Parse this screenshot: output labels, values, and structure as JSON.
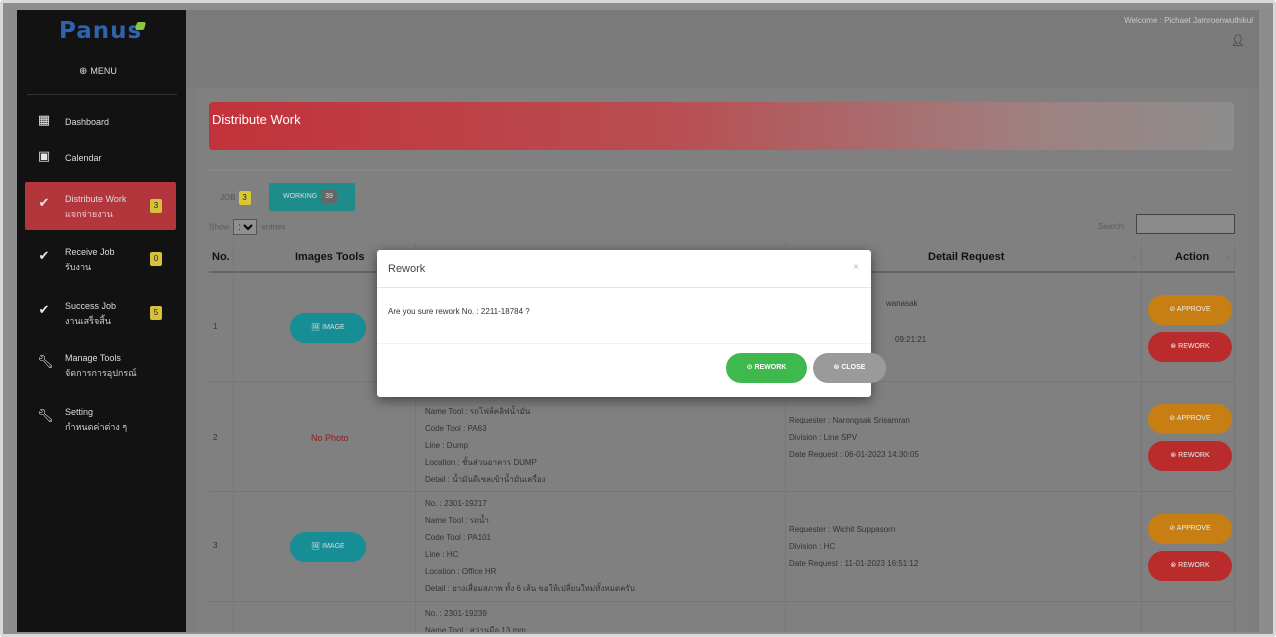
{
  "app": {
    "logo": "Panus",
    "menu_label": "MENU",
    "welcome": "Welcome : Pichaet Jamroenwuthikul"
  },
  "sidebar": {
    "items": [
      {
        "icon": "dashboard-icon",
        "label": "Dashboard",
        "sub": "",
        "badge": ""
      },
      {
        "icon": "calendar-icon",
        "label": "Calendar",
        "sub": "",
        "badge": ""
      },
      {
        "icon": "check-icon",
        "label": "Distribute Work",
        "sub": "แจกจ่ายงาน",
        "badge": "3",
        "active": true
      },
      {
        "icon": "check-icon",
        "label": "Receive Job",
        "sub": "รับงาน",
        "badge": "0"
      },
      {
        "icon": "check-icon",
        "label": "Success Job",
        "sub": "งานเสร็จสิ้น",
        "badge": "5"
      },
      {
        "icon": "wrench-icon",
        "label": "Manage Tools",
        "sub": "จัดการการอุปกรณ์",
        "badge": ""
      },
      {
        "icon": "wrench-icon",
        "label": "Setting",
        "sub": "กำหนดค่าต่าง ๆ",
        "badge": ""
      }
    ]
  },
  "page": {
    "title": "Distribute Work",
    "tab_job": {
      "label": "JOB",
      "count": "3"
    },
    "tab_working": {
      "label": "WORKING",
      "count": "39"
    },
    "show_label": "Show",
    "entries_value": "10",
    "entries_label": "entries",
    "search_label": "Search:"
  },
  "table": {
    "headers": {
      "no": "No.",
      "images": "Images Tools",
      "detail_request": "Detail Request",
      "action": "Action"
    },
    "image_button": "IMAGE",
    "no_photo": "No Photo",
    "approve": "APPROVE",
    "rework": "REWORK",
    "rows": [
      {
        "no": "1",
        "has_image": true,
        "tool": [],
        "request": [
          "wanasak",
          "",
          "09:21:21"
        ]
      },
      {
        "no": "2",
        "has_image": false,
        "tool": [
          "Name Tool : รถโฟล์คลิฟน้ำมัน",
          "Code Tool : PA63",
          "Line : Dump",
          "Location : ชั้นส่วนอาคาร DUMP",
          "Detail : น้ำมันดีเซลเข้าน้ำมันเครื่อง"
        ],
        "request": [
          "Requester : Narongsak Srisamran",
          "Division : Line SPV",
          "Date Request : 06-01-2023 14:30:05"
        ]
      },
      {
        "no": "3",
        "has_image": true,
        "tool": [
          "No. : 2301-19217",
          "Name Tool : รถน้ำ",
          "Code Tool : PA101",
          "Line : HC",
          "Location : Office HR",
          "Detail : ยางเสื่อมสภาพ ทั้ง 6 เส้น ขอให้เปลี่ยนใหม่ทั้งหมดครับ"
        ],
        "request": [
          "Requester : Wichit Suppasorn",
          "Division : HC",
          "Date Request : 11-01-2023 16:51:12"
        ]
      },
      {
        "no": "",
        "has_image": false,
        "tool": [
          "No. : 2301-19239",
          "Name Tool : สว่านมือ 13 mm"
        ],
        "request": []
      }
    ]
  },
  "modal": {
    "title": "Rework",
    "close_x": "×",
    "message": "Are you sure rework No. : 2211-18784 ?",
    "rework_button": "REWORK",
    "close_button": "CLOSE"
  }
}
